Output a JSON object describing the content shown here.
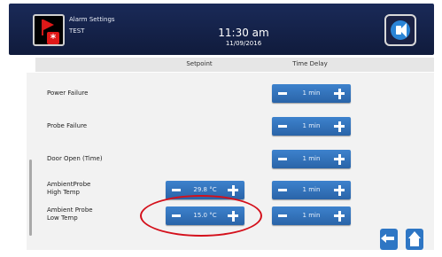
{
  "header": {
    "title": "Alarm Settings",
    "subtitle": "TEST",
    "time": "11:30 am",
    "date": "11/09/2016",
    "alarm_icon": "alarm-flag-icon",
    "sound_icon": "speaker-icon"
  },
  "columns": {
    "setpoint": "Setpoint",
    "time_delay": "Time Delay"
  },
  "rows": [
    {
      "label": "Power Failure",
      "setpoint": null,
      "delay": "1 min"
    },
    {
      "label": "Probe Failure",
      "setpoint": null,
      "delay": "1 min"
    },
    {
      "label": "Door Open (Time)",
      "setpoint": null,
      "delay": "1 min"
    },
    {
      "label_line1": "AmbientProbe",
      "label_line2": "High Temp",
      "setpoint": "29.8 °C",
      "delay": "1 min"
    },
    {
      "label_line1": "Ambient Probe",
      "label_line2": "Low Temp",
      "setpoint": "15.0 °C",
      "delay": "1 min"
    }
  ],
  "nav": {
    "back_icon": "back-arrow-icon",
    "home_icon": "home-icon"
  },
  "colors": {
    "header_bg": "#101b3c",
    "stepper_blue": "#2a64a8",
    "highlight_red": "#d4101b"
  }
}
